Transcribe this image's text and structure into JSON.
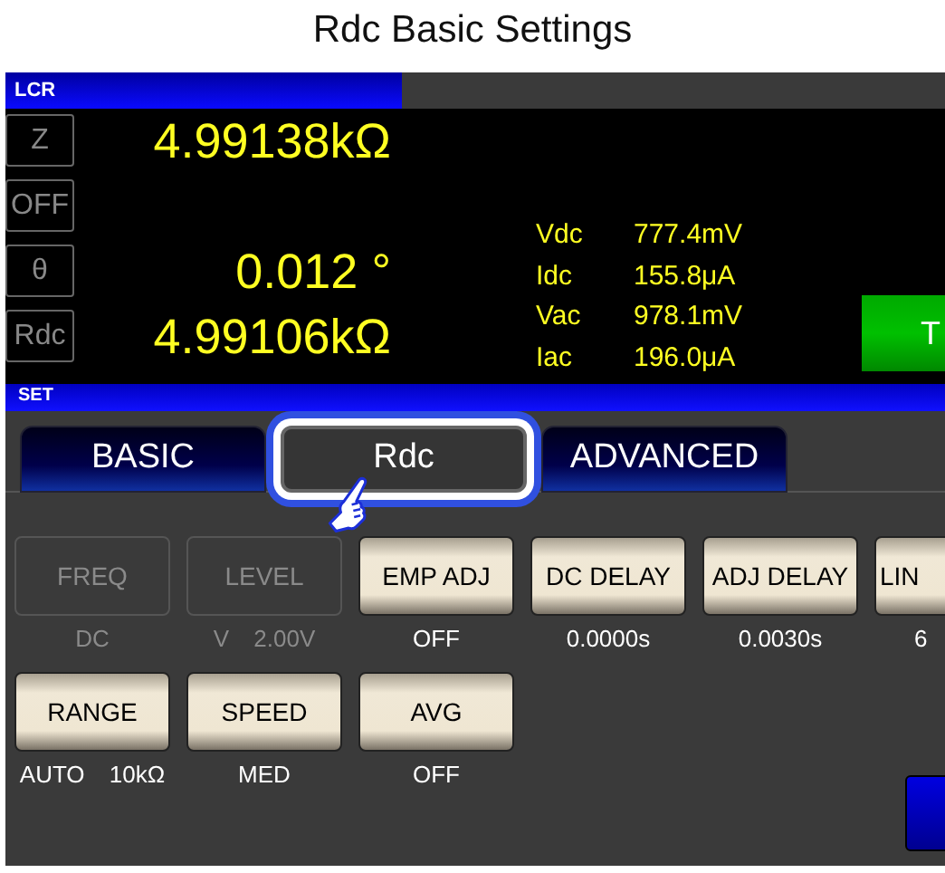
{
  "window": {
    "title": "Rdc Basic Settings"
  },
  "lcr_panel": {
    "header": "LCR",
    "parameters": [
      {
        "name": "Z",
        "value": "4.99138kΩ"
      },
      {
        "name": "OFF"
      },
      {
        "name": "θ",
        "value": "0.012 °"
      },
      {
        "name": "Rdc",
        "value": "4.99106kΩ"
      }
    ],
    "monitor": [
      {
        "label": "Vdc",
        "value": "777.4mV"
      },
      {
        "label": "Idc",
        "value": "155.8μA"
      },
      {
        "label": "Vac",
        "value": "978.1mV"
      },
      {
        "label": "Iac",
        "value": "196.0μA"
      }
    ],
    "side_button": {
      "label": "T"
    }
  },
  "set_panel": {
    "header": "SET",
    "tabs": [
      {
        "label": "BASIC",
        "selected": false
      },
      {
        "label": "Rdc",
        "selected": true
      },
      {
        "label": "ADVANCED",
        "selected": false
      }
    ],
    "settings_rows": [
      [
        {
          "label": "FREQ",
          "value": "DC",
          "disabled": true
        },
        {
          "label": "LEVEL",
          "value": "V 2.00V",
          "disabled": true
        },
        {
          "label": "EMP ADJ",
          "value": "OFF",
          "disabled": false
        },
        {
          "label": "DC DELAY",
          "value": "0.0000s",
          "disabled": false
        },
        {
          "label": "ADJ DELAY",
          "value": "0.0030s",
          "disabled": false
        },
        {
          "label": "LIN",
          "value": "6",
          "disabled": false
        }
      ],
      [
        {
          "label": "RANGE",
          "value": "AUTO 10kΩ",
          "disabled": false
        },
        {
          "label": "SPEED",
          "value": "MED",
          "disabled": false
        },
        {
          "label": "AVG",
          "value": "OFF",
          "disabled": false
        }
      ]
    ]
  }
}
